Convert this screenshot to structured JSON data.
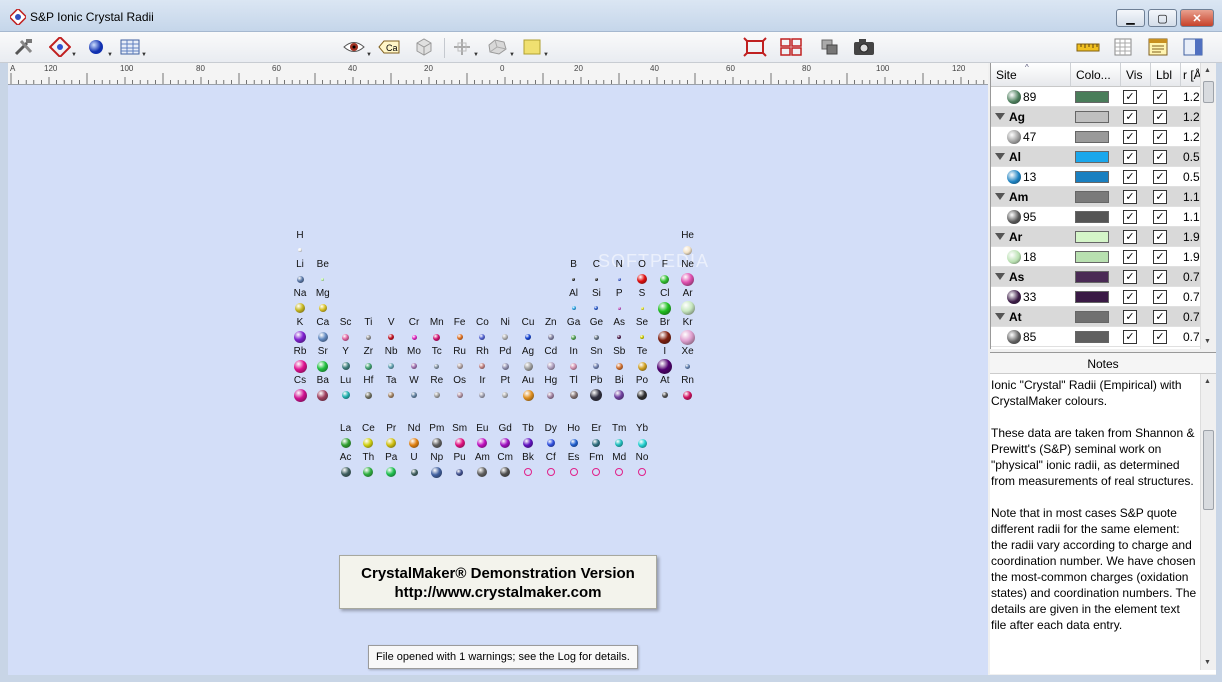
{
  "window": {
    "title": "S&P Ionic Crystal Radii"
  },
  "window_controls": {
    "minimize": "▁",
    "maximize": "▢",
    "close": "✕"
  },
  "ruler": {
    "labels": [
      "A",
      "120",
      "100",
      "80",
      "60",
      "40",
      "20",
      "0",
      "20",
      "40",
      "60",
      "80",
      "100",
      "120"
    ]
  },
  "status": {
    "message": "File opened with 1 warnings; see the Log for details."
  },
  "demo": {
    "line1": "CrystalMaker® Demonstration Version",
    "line2": "http://www.crystalmaker.com"
  },
  "watermark": "SOFTPEDIA",
  "elements": [
    {
      "s": "H",
      "r": 1,
      "c": 1,
      "col": "#f2f2f2",
      "d": 4
    },
    {
      "s": "He",
      "r": 1,
      "c": 18,
      "col": "#f4e4c8",
      "d": 9
    },
    {
      "s": "Li",
      "r": 2,
      "c": 1,
      "col": "#5a78a8",
      "d": 7
    },
    {
      "s": "Be",
      "r": 2,
      "c": 2,
      "col": "#b8f0a0",
      "d": 3
    },
    {
      "s": "B",
      "r": 2,
      "c": 13,
      "col": "#202020",
      "d": 3
    },
    {
      "s": "C",
      "r": 2,
      "c": 14,
      "col": "#202020",
      "d": 3
    },
    {
      "s": "N",
      "r": 2,
      "c": 15,
      "col": "#4060d0",
      "d": 3
    },
    {
      "s": "O",
      "r": 2,
      "c": 16,
      "col": "#e01010",
      "d": 10
    },
    {
      "s": "F",
      "r": 2,
      "c": 17,
      "col": "#30c030",
      "d": 9
    },
    {
      "s": "Ne",
      "r": 2,
      "c": 18,
      "col": "#e050b0",
      "d": 13
    },
    {
      "s": "Na",
      "r": 3,
      "c": 1,
      "col": "#c8b820",
      "d": 10
    },
    {
      "s": "Mg",
      "r": 3,
      "c": 2,
      "col": "#d8c020",
      "d": 8
    },
    {
      "s": "Al",
      "r": 3,
      "c": 13,
      "col": "#30a8e8",
      "d": 4
    },
    {
      "s": "Si",
      "r": 3,
      "c": 14,
      "col": "#3060d0",
      "d": 4
    },
    {
      "s": "P",
      "r": 3,
      "c": 15,
      "col": "#c050c0",
      "d": 3
    },
    {
      "s": "S",
      "r": 3,
      "c": 16,
      "col": "#e0e020",
      "d": 3
    },
    {
      "s": "Cl",
      "r": 3,
      "c": 17,
      "col": "#20c020",
      "d": 13
    },
    {
      "s": "Ar",
      "r": 3,
      "c": 18,
      "col": "#c8e8c0",
      "d": 14
    },
    {
      "s": "K",
      "r": 4,
      "c": 1,
      "col": "#8020d0",
      "d": 12
    },
    {
      "s": "Ca",
      "r": 4,
      "c": 2,
      "col": "#6088c0",
      "d": 10
    },
    {
      "s": "Sc",
      "r": 4,
      "c": 3,
      "col": "#e060a0",
      "d": 7
    },
    {
      "s": "Ti",
      "r": 4,
      "c": 4,
      "col": "#909090",
      "d": 5
    },
    {
      "s": "V",
      "r": 4,
      "c": 5,
      "col": "#c01020",
      "d": 6
    },
    {
      "s": "Cr",
      "r": 4,
      "c": 6,
      "col": "#e020c0",
      "d": 5
    },
    {
      "s": "Mn",
      "r": 4,
      "c": 7,
      "col": "#d01070",
      "d": 7
    },
    {
      "s": "Fe",
      "r": 4,
      "c": 8,
      "col": "#e07020",
      "d": 6
    },
    {
      "s": "Co",
      "r": 4,
      "c": 9,
      "col": "#5060d0",
      "d": 6
    },
    {
      "s": "Ni",
      "r": 4,
      "c": 10,
      "col": "#b0b0b0",
      "d": 6
    },
    {
      "s": "Cu",
      "r": 4,
      "c": 11,
      "col": "#1040d0",
      "d": 6
    },
    {
      "s": "Zn",
      "r": 4,
      "c": 12,
      "col": "#8080a0",
      "d": 6
    },
    {
      "s": "Ga",
      "r": 4,
      "c": 13,
      "col": "#50a050",
      "d": 5
    },
    {
      "s": "Ge",
      "r": 4,
      "c": 14,
      "col": "#607080",
      "d": 5
    },
    {
      "s": "As",
      "r": 4,
      "c": 15,
      "col": "#502050",
      "d": 4
    },
    {
      "s": "Se",
      "r": 4,
      "c": 16,
      "col": "#d0d000",
      "d": 4
    },
    {
      "s": "Br",
      "r": 4,
      "c": 17,
      "col": "#802010",
      "d": 13
    },
    {
      "s": "Kr",
      "r": 4,
      "c": 18,
      "col": "#e0a0d0",
      "d": 15
    },
    {
      "s": "Rb",
      "r": 5,
      "c": 1,
      "col": "#e01090",
      "d": 13
    },
    {
      "s": "Sr",
      "r": 5,
      "c": 2,
      "col": "#20c040",
      "d": 11
    },
    {
      "s": "Y",
      "r": 5,
      "c": 3,
      "col": "#408080",
      "d": 8
    },
    {
      "s": "Zr",
      "r": 5,
      "c": 4,
      "col": "#40a070",
      "d": 7
    },
    {
      "s": "Nb",
      "r": 5,
      "c": 5,
      "col": "#60a0b0",
      "d": 6
    },
    {
      "s": "Mo",
      "r": 5,
      "c": 6,
      "col": "#a070b0",
      "d": 6
    },
    {
      "s": "Tc",
      "r": 5,
      "c": 7,
      "col": "#8090a0",
      "d": 5
    },
    {
      "s": "Ru",
      "r": 5,
      "c": 8,
      "col": "#b0a0a0",
      "d": 6
    },
    {
      "s": "Rh",
      "r": 5,
      "c": 9,
      "col": "#c08080",
      "d": 6
    },
    {
      "s": "Pd",
      "r": 5,
      "c": 10,
      "col": "#9090b0",
      "d": 7
    },
    {
      "s": "Ag",
      "r": 5,
      "c": 11,
      "col": "#a0a0a0",
      "d": 9
    },
    {
      "s": "Cd",
      "r": 5,
      "c": 12,
      "col": "#b0a0c0",
      "d": 8
    },
    {
      "s": "In",
      "r": 5,
      "c": 13,
      "col": "#d090b0",
      "d": 7
    },
    {
      "s": "Sn",
      "r": 5,
      "c": 14,
      "col": "#7080b0",
      "d": 6
    },
    {
      "s": "Sb",
      "r": 5,
      "c": 15,
      "col": "#d07030",
      "d": 7
    },
    {
      "s": "Te",
      "r": 5,
      "c": 16,
      "col": "#d0a020",
      "d": 9
    },
    {
      "s": "I",
      "r": 5,
      "c": 17,
      "col": "#500070",
      "d": 15
    },
    {
      "s": "Xe",
      "r": 5,
      "c": 18,
      "col": "#6080b0",
      "d": 5
    },
    {
      "s": "Cs",
      "r": 6,
      "c": 1,
      "col": "#d01090",
      "d": 13
    },
    {
      "s": "Ba",
      "r": 6,
      "c": 2,
      "col": "#a04060",
      "d": 11
    },
    {
      "s": "Lu",
      "r": 6,
      "c": 3,
      "col": "#20b0b0",
      "d": 8
    },
    {
      "s": "Hf",
      "r": 6,
      "c": 4,
      "col": "#707060",
      "d": 7
    },
    {
      "s": "Ta",
      "r": 6,
      "c": 5,
      "col": "#a08060",
      "d": 6
    },
    {
      "s": "W",
      "r": 6,
      "c": 6,
      "col": "#6080a0",
      "d": 6
    },
    {
      "s": "Re",
      "r": 6,
      "c": 7,
      "col": "#a0a0a0",
      "d": 6
    },
    {
      "s": "Os",
      "r": 6,
      "c": 8,
      "col": "#b090a0",
      "d": 6
    },
    {
      "s": "Ir",
      "r": 6,
      "c": 9,
      "col": "#a0a0b0",
      "d": 6
    },
    {
      "s": "Pt",
      "r": 6,
      "c": 10,
      "col": "#b0b0b0",
      "d": 6
    },
    {
      "s": "Au",
      "r": 6,
      "c": 11,
      "col": "#e09020",
      "d": 11
    },
    {
      "s": "Hg",
      "r": 6,
      "c": 12,
      "col": "#a080a0",
      "d": 7
    },
    {
      "s": "Tl",
      "r": 6,
      "c": 13,
      "col": "#807070",
      "d": 8
    },
    {
      "s": "Pb",
      "r": 6,
      "c": 14,
      "col": "#303040",
      "d": 12
    },
    {
      "s": "Bi",
      "r": 6,
      "c": 15,
      "col": "#7040a0",
      "d": 10
    },
    {
      "s": "Po",
      "r": 6,
      "c": 16,
      "col": "#303030",
      "d": 10
    },
    {
      "s": "At",
      "r": 6,
      "c": 17,
      "col": "#505050",
      "d": 6
    },
    {
      "s": "Rn",
      "r": 6,
      "c": 18,
      "col": "#d01060",
      "d": 9
    },
    {
      "s": "La",
      "r": 8,
      "c": 3,
      "col": "#30a030",
      "d": 10
    },
    {
      "s": "Ce",
      "r": 8,
      "c": 4,
      "col": "#d0d010",
      "d": 10
    },
    {
      "s": "Pr",
      "r": 8,
      "c": 5,
      "col": "#d0c010",
      "d": 10
    },
    {
      "s": "Nd",
      "r": 8,
      "c": 6,
      "col": "#e08010",
      "d": 10
    },
    {
      "s": "Pm",
      "r": 8,
      "c": 7,
      "col": "#606060",
      "d": 10
    },
    {
      "s": "Sm",
      "r": 8,
      "c": 8,
      "col": "#e01080",
      "d": 10
    },
    {
      "s": "Eu",
      "r": 8,
      "c": 9,
      "col": "#c010c0",
      "d": 10
    },
    {
      "s": "Gd",
      "r": 8,
      "c": 10,
      "col": "#a010c0",
      "d": 10
    },
    {
      "s": "Tb",
      "r": 8,
      "c": 11,
      "col": "#6010c0",
      "d": 10
    },
    {
      "s": "Dy",
      "r": 8,
      "c": 12,
      "col": "#3050e0",
      "d": 8
    },
    {
      "s": "Ho",
      "r": 8,
      "c": 13,
      "col": "#2060d0",
      "d": 8
    },
    {
      "s": "Er",
      "r": 8,
      "c": 14,
      "col": "#307080",
      "d": 8
    },
    {
      "s": "Tm",
      "r": 8,
      "c": 15,
      "col": "#20c0c0",
      "d": 8
    },
    {
      "s": "Yb",
      "r": 8,
      "c": 16,
      "col": "#20d0d0",
      "d": 9
    },
    {
      "s": "Ac",
      "r": 9,
      "c": 3,
      "col": "#406060",
      "d": 10
    },
    {
      "s": "Th",
      "r": 9,
      "c": 4,
      "col": "#30b040",
      "d": 10
    },
    {
      "s": "Pa",
      "r": 9,
      "c": 5,
      "col": "#20c050",
      "d": 10
    },
    {
      "s": "U",
      "r": 9,
      "c": 6,
      "col": "#406060",
      "d": 7
    },
    {
      "s": "Np",
      "r": 9,
      "c": 7,
      "col": "#4060a0",
      "d": 11
    },
    {
      "s": "Pu",
      "r": 9,
      "c": 8,
      "col": "#405090",
      "d": 7
    },
    {
      "s": "Am",
      "r": 9,
      "c": 9,
      "col": "#606060",
      "d": 10
    },
    {
      "s": "Cm",
      "r": 9,
      "c": 10,
      "col": "#505050",
      "d": 10
    },
    {
      "s": "Bk",
      "r": 9,
      "c": 11,
      "col": "ring",
      "d": 8
    },
    {
      "s": "Cf",
      "r": 9,
      "c": 12,
      "col": "ring",
      "d": 8
    },
    {
      "s": "Es",
      "r": 9,
      "c": 13,
      "col": "ring",
      "d": 8
    },
    {
      "s": "Fm",
      "r": 9,
      "c": 14,
      "col": "ring",
      "d": 8
    },
    {
      "s": "Md",
      "r": 9,
      "c": 15,
      "col": "ring",
      "d": 8
    },
    {
      "s": "No",
      "r": 9,
      "c": 16,
      "col": "ring",
      "d": 8
    }
  ],
  "sites": {
    "headers": {
      "site": "Site",
      "colour": "Colo...",
      "vis": "Vis",
      "lbl": "Lbl",
      "radius": "r [Å"
    },
    "rows": [
      {
        "type": "site",
        "label": "89",
        "color": "#4a7d5a",
        "radius": "1.2"
      },
      {
        "type": "group",
        "label": "Ag",
        "color": "#bfbfbf",
        "radius": "1.2"
      },
      {
        "type": "site",
        "label": "47",
        "color": "#9a9a9a",
        "radius": "1.2"
      },
      {
        "type": "group",
        "label": "Al",
        "color": "#1aa7ec",
        "radius": "0.5"
      },
      {
        "type": "site",
        "label": "13",
        "color": "#1a80c0",
        "radius": "0.5"
      },
      {
        "type": "group",
        "label": "Am",
        "color": "#7a7a7a",
        "radius": "1.1"
      },
      {
        "type": "site",
        "label": "95",
        "color": "#555555",
        "radius": "1.1"
      },
      {
        "type": "group",
        "label": "Ar",
        "color": "#d4f5c8",
        "radius": "1.9"
      },
      {
        "type": "site",
        "label": "18",
        "color": "#b8e0b0",
        "radius": "1.9"
      },
      {
        "type": "group",
        "label": "As",
        "color": "#4a2a55",
        "radius": "0.7"
      },
      {
        "type": "site",
        "label": "33",
        "color": "#3a1a45",
        "radius": "0.7"
      },
      {
        "type": "group",
        "label": "At",
        "color": "#707070",
        "radius": "0.7"
      },
      {
        "type": "site",
        "label": "85",
        "color": "#606060",
        "radius": "0.7"
      }
    ]
  },
  "notes": {
    "title": "Notes",
    "paragraphs": [
      "Ionic \"Crystal\" Radii (Empirical) with CrystalMaker colours.",
      "These data are taken from Shannon & Prewitt's (S&P) seminal work on \"physical\" ionic radii, as determined from measurements of real structures.",
      "Note that in most cases S&P quote different radii for the same element: the radii vary according to charge and coordination number. We have chosen the most-common charges (oxidation states) and coordination numbers. The details are given in the element text file after each data entry."
    ]
  }
}
